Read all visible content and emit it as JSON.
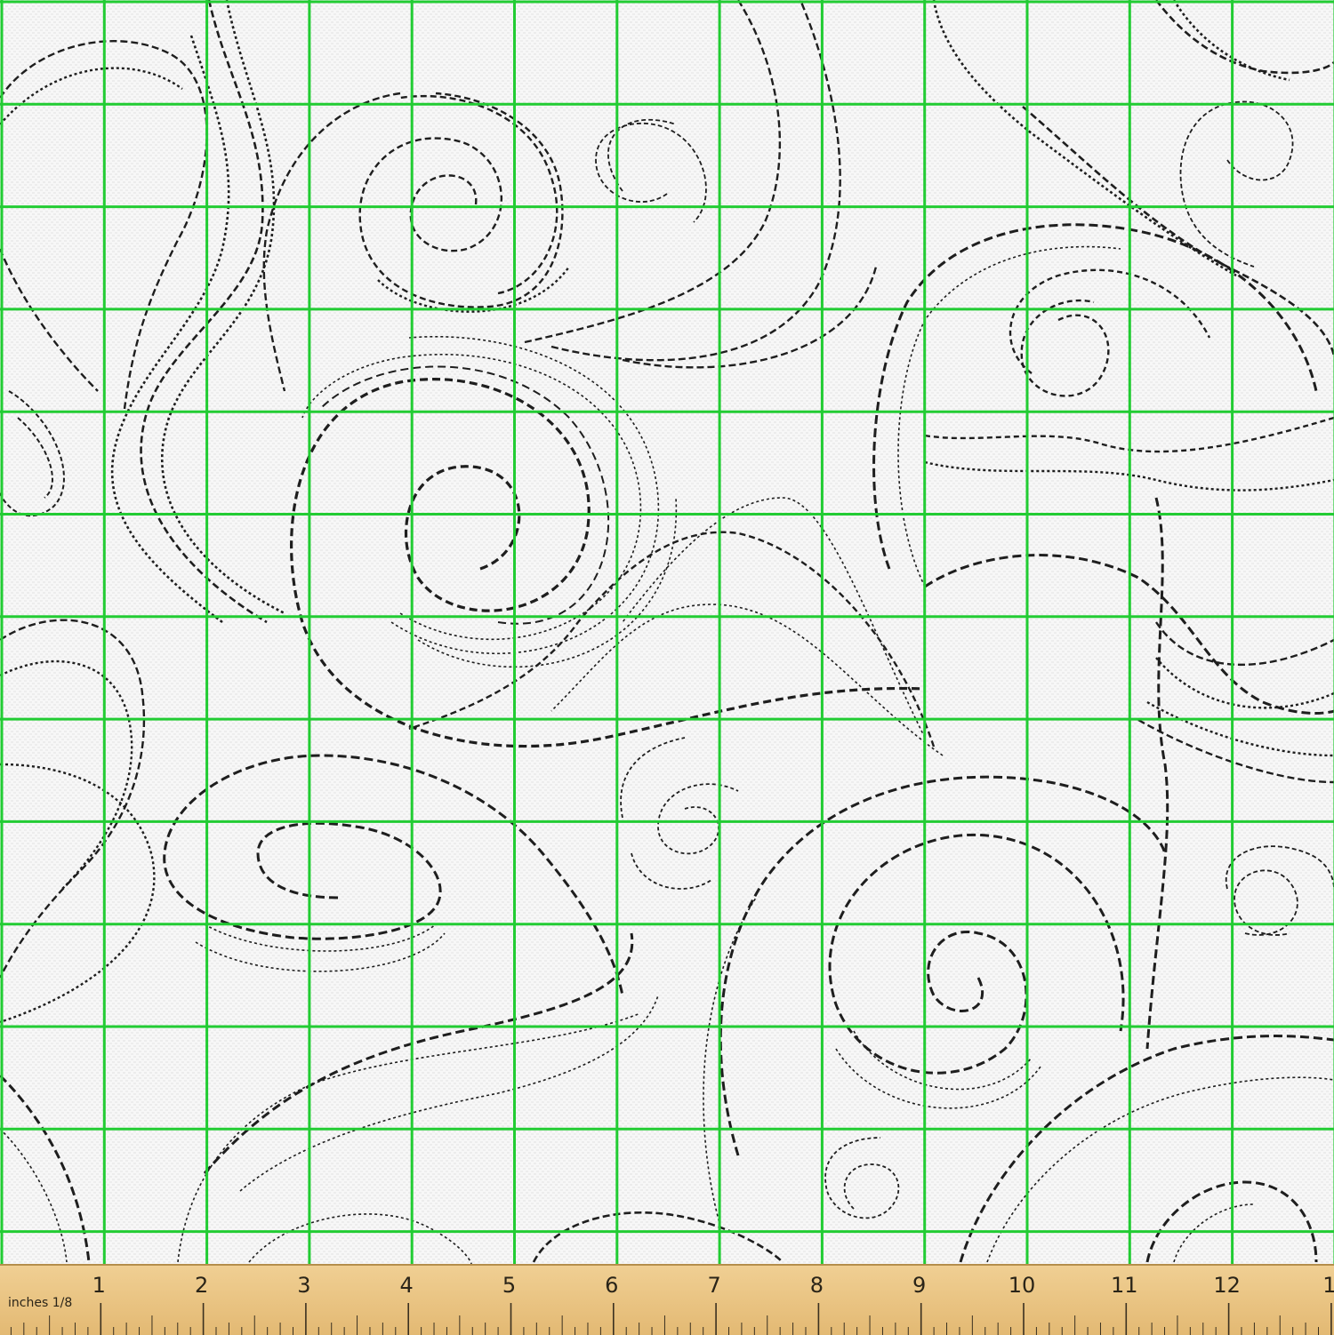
{
  "pattern": {
    "motif": "dashed-swirl-line-art",
    "background_color": "#f7f7f7",
    "line_color": "#1e1e1e",
    "grid_color": "#22cc33",
    "grid_spacing_inches": 1
  },
  "ruler": {
    "unit_label": "inches 1/8",
    "numbers": [
      "1",
      "2",
      "3",
      "4",
      "5",
      "6",
      "7",
      "8",
      "9",
      "10",
      "11",
      "12",
      "1"
    ],
    "color": "#e9c27f"
  }
}
